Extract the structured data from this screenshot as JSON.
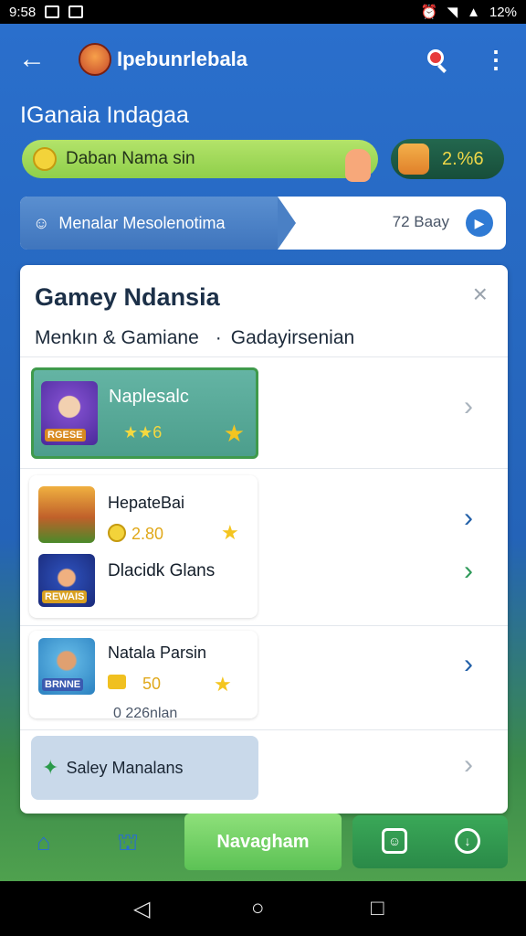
{
  "status_bar": {
    "time": "9:58",
    "battery": "12%"
  },
  "header": {
    "app_name": "Ipebunrlebala"
  },
  "page": {
    "title": "IGanaia Indagaa"
  },
  "search": {
    "text": "Daban Nama sin"
  },
  "points": {
    "value": "2.%6"
  },
  "banner": {
    "label": "Menalar Mesolenotima",
    "days": "72 Baay"
  },
  "card": {
    "title": "Gamey Ndansia",
    "filter_left": "Menkın & Gamiane",
    "filter_right": "Gadayirsenian",
    "featured": {
      "name": "Naplesalc",
      "thumb_label": "RGESE",
      "rating": "★★6"
    },
    "items": [
      {
        "name": "HepateBai",
        "value": "2.80"
      },
      {
        "name": "Dlacidk Glans",
        "thumb_label": "REWAIS"
      },
      {
        "name": "Natala Parsin",
        "value": "50",
        "meta": "0 226nlan",
        "thumb_label": "BRNNE"
      }
    ],
    "safety": {
      "label": "Saley Manalans"
    }
  },
  "bottom_nav": {
    "main_label": "Navagham"
  },
  "colors": {
    "primary_blue": "#2a6fcc",
    "accent_green": "#5cc255",
    "dark_green": "#2a8a48"
  }
}
